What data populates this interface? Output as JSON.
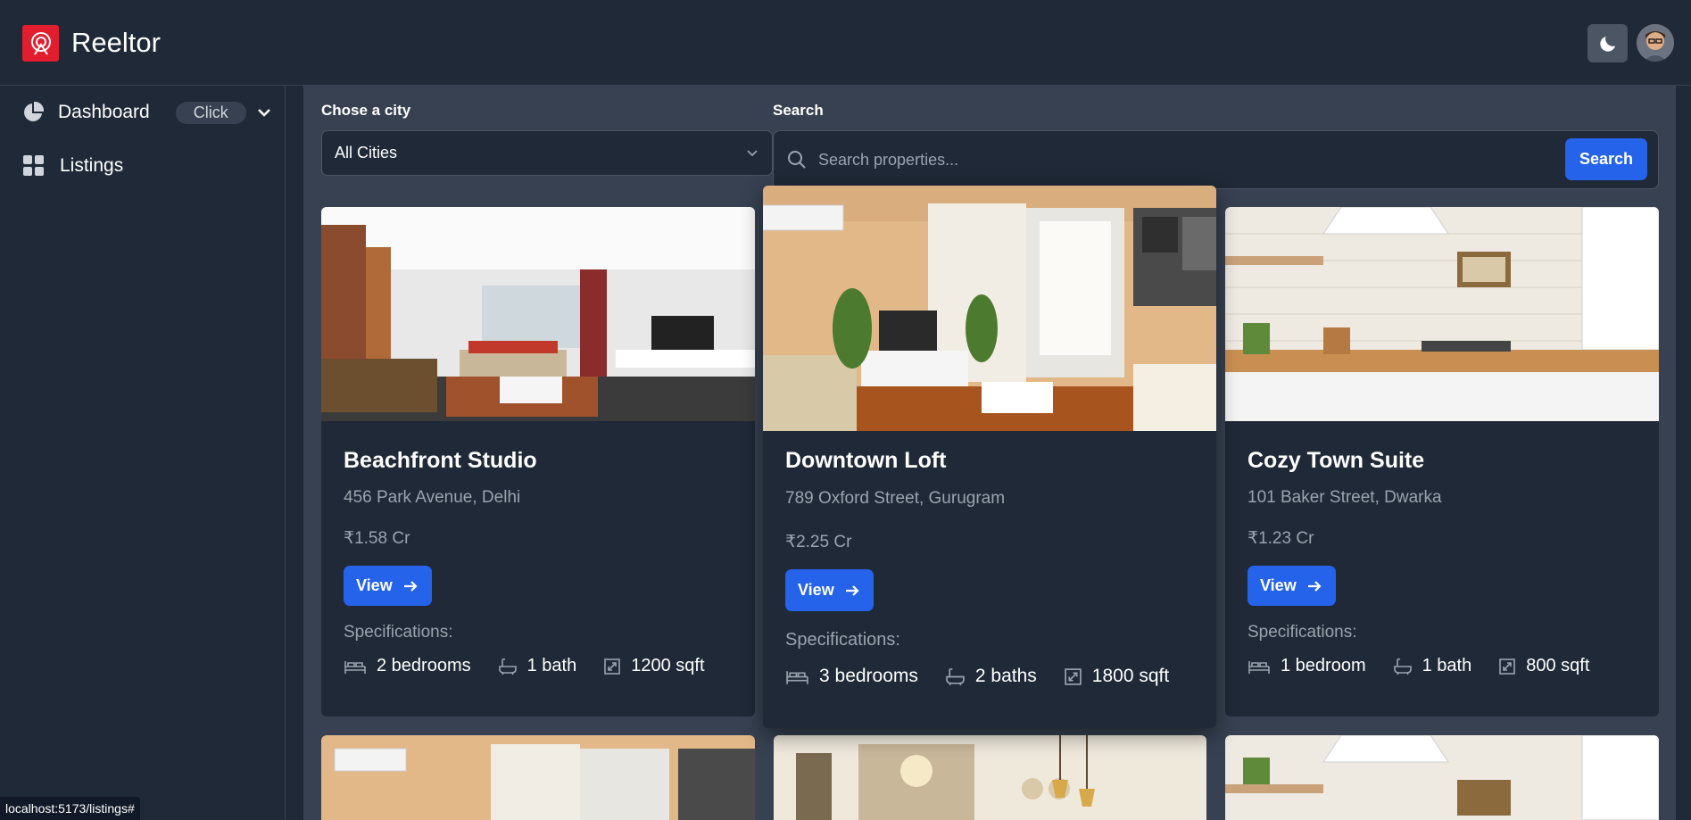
{
  "header": {
    "app_title": "Reeltor"
  },
  "sidebar": {
    "items": [
      {
        "label": "Dashboard",
        "badge": "Click"
      },
      {
        "label": "Listings"
      }
    ]
  },
  "filters": {
    "city_label": "Chose a city",
    "city_value": "All Cities",
    "search_label": "Search",
    "search_placeholder": "Search properties...",
    "search_button": "Search"
  },
  "listings": [
    {
      "title": "Beachfront Studio",
      "address": "456 Park Avenue, Delhi",
      "price": "₹1.58 Cr",
      "view": "View",
      "spec_label": "Specifications:",
      "bedrooms": "2 bedrooms",
      "baths": "1 bath",
      "area": "1200 sqft"
    },
    {
      "title": "Downtown Loft",
      "address": "789 Oxford Street, Gurugram",
      "price": "₹2.25 Cr",
      "view": "View",
      "spec_label": "Specifications:",
      "bedrooms": "3 bedrooms",
      "baths": "2 baths",
      "area": "1800 sqft"
    },
    {
      "title": "Cozy Town Suite",
      "address": "101 Baker Street, Dwarka",
      "price": "₹1.23 Cr",
      "view": "View",
      "spec_label": "Specifications:",
      "bedrooms": "1 bedroom",
      "baths": "1 bath",
      "area": "800 sqft"
    }
  ],
  "status_bar": {
    "url": "localhost:5173/listings#"
  },
  "colors": {
    "accent": "#2563eb",
    "background": "#1f2937",
    "panel": "#374151",
    "brand": "#e11d2e"
  },
  "icons": [
    "logo-icon",
    "moon-icon",
    "pie-chart-icon",
    "chevron-down-icon",
    "grid-icon",
    "search-icon",
    "arrow-right-icon",
    "bed-icon",
    "bath-icon",
    "area-icon"
  ]
}
